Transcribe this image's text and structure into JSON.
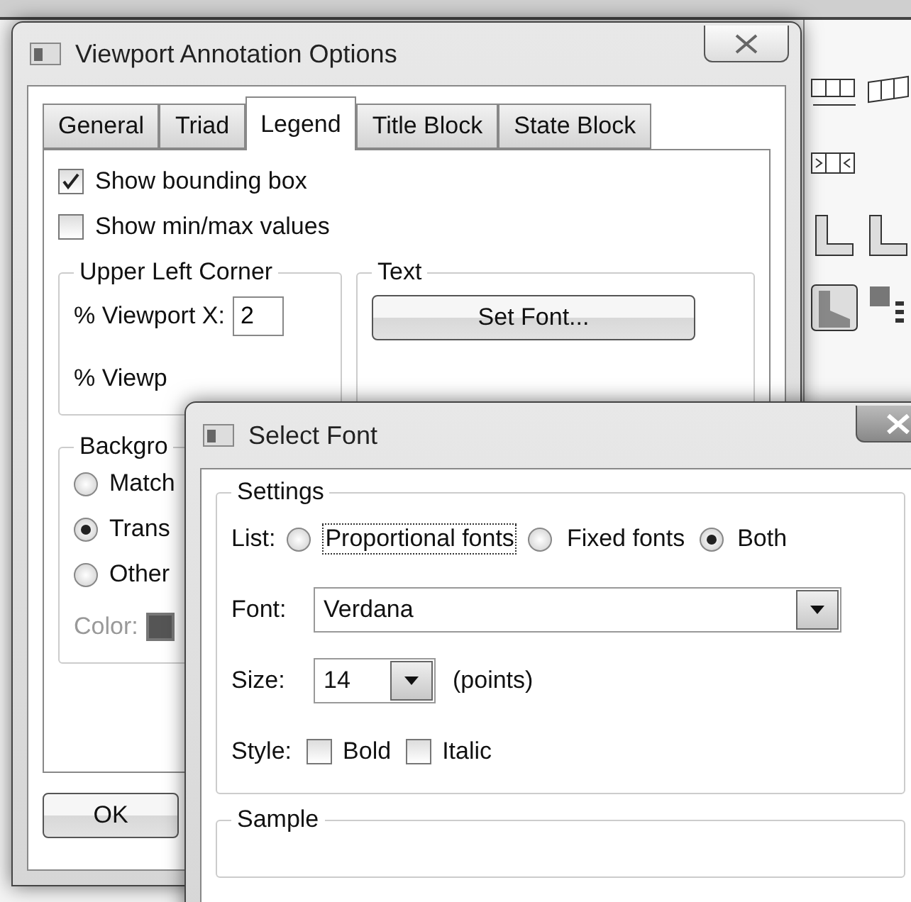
{
  "annotation_window": {
    "title": "Viewport Annotation Options",
    "tabs": [
      {
        "label": "General",
        "selected": false
      },
      {
        "label": "Triad",
        "selected": false
      },
      {
        "label": "Legend",
        "selected": true
      },
      {
        "label": "Title Block",
        "selected": false
      },
      {
        "label": "State Block",
        "selected": false
      }
    ],
    "options": [
      {
        "label": "Show bounding box",
        "checked": true
      },
      {
        "label": "Show min/max values",
        "checked": false
      }
    ],
    "corner_group": {
      "title": "Upper Left Corner",
      "fields": [
        {
          "label": "% Viewport X:",
          "value": "2"
        },
        {
          "label": "% Viewp"
        }
      ]
    },
    "text_group": {
      "title": "Text",
      "button": "Set Font..."
    },
    "background_group": {
      "title": "Backgro",
      "choices": [
        {
          "label": "Match",
          "selected": false
        },
        {
          "label": "Trans",
          "selected": true
        },
        {
          "label": "Other",
          "selected": false
        }
      ],
      "color_label": "Color:",
      "color_disabled": true
    },
    "buttons": [
      "OK"
    ]
  },
  "font_window": {
    "title": "Select Font",
    "settings": {
      "title": "Settings",
      "list_label": "List:",
      "list_options": [
        {
          "label": "Proportional fonts",
          "selected": false,
          "focused": true
        },
        {
          "label": "Fixed fonts",
          "selected": false,
          "focused": false
        },
        {
          "label": "Both",
          "selected": true,
          "focused": false
        }
      ],
      "font_label": "Font:",
      "font": "Verdana",
      "size_label": "Size:",
      "size": "14",
      "size_unit": "(points)",
      "style_label": "Style:",
      "styles": [
        {
          "label": "Bold",
          "checked": false
        },
        {
          "label": "Italic",
          "checked": false
        }
      ]
    },
    "sample_title": "Sample"
  }
}
